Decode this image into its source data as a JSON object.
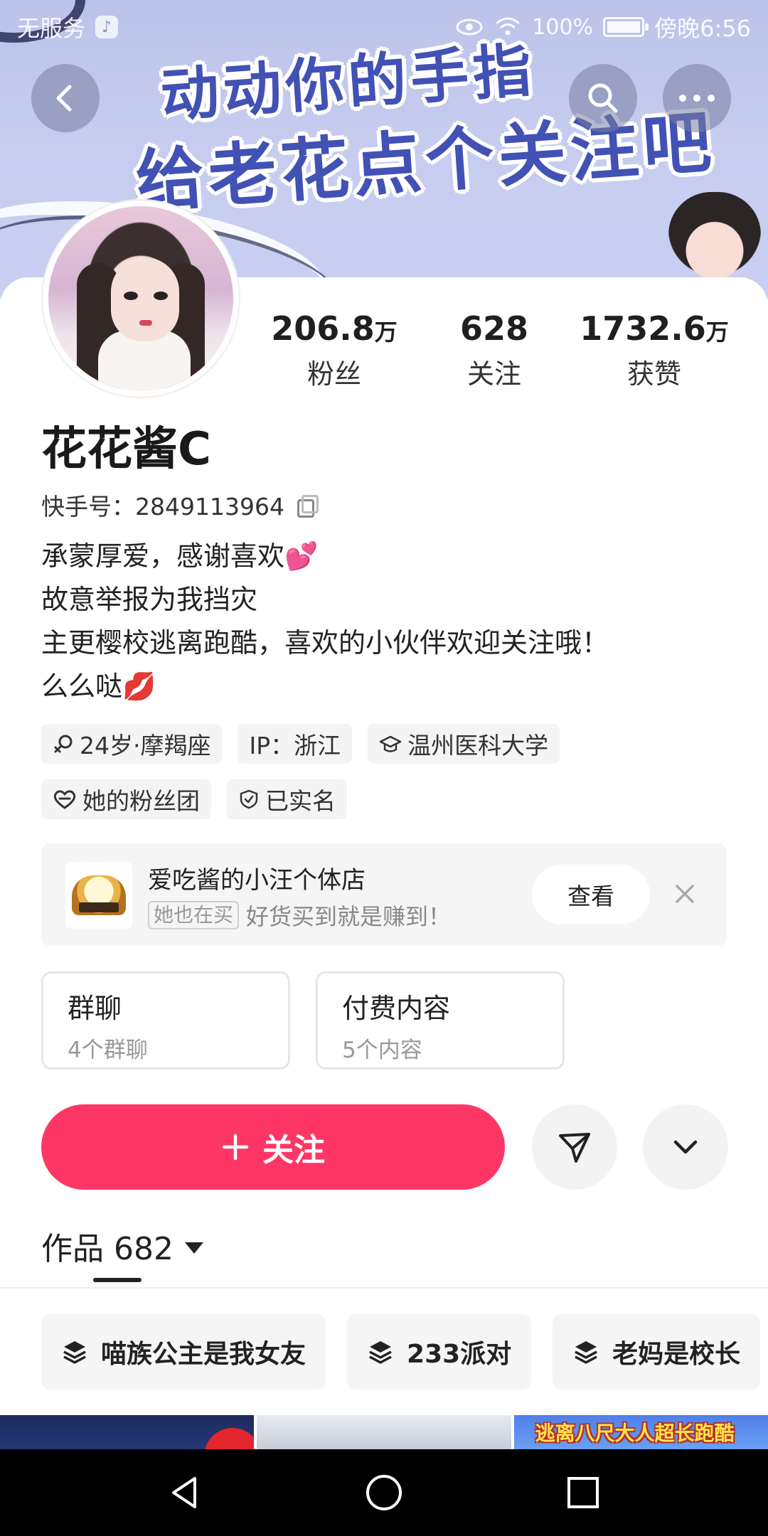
{
  "status_bar": {
    "carrier": "无服务",
    "battery": "100%",
    "time": "傍晚6:56",
    "icons": [
      "music-app-icon",
      "eye-icon",
      "wifi-icon",
      "battery-icon"
    ]
  },
  "banner": {
    "line1": "动动你的手指",
    "line2": "给老花点个关注吧"
  },
  "profile": {
    "stats": [
      {
        "value": "206.8",
        "unit": "万",
        "label": "粉丝"
      },
      {
        "value": "628",
        "unit": "",
        "label": "关注"
      },
      {
        "value": "1732.6",
        "unit": "万",
        "label": "获赞"
      }
    ],
    "name": "花花酱C",
    "kuaishou_id": "快手号：2849113964",
    "bio": [
      {
        "text": "承蒙厚爱，感谢喜欢",
        "emoji": "💕"
      },
      {
        "text": "故意举报为我挡灾",
        "emoji": ""
      },
      {
        "text": "主更樱校逃离跑酷，喜欢的小伙伴欢迎关注哦！",
        "emoji": ""
      },
      {
        "text": "么么哒",
        "emoji": "💋"
      }
    ],
    "tags_row1": [
      {
        "icon": "female-icon",
        "label": "24岁·摩羯座"
      },
      {
        "icon": "",
        "label": "IP：浙江"
      },
      {
        "icon": "graduation-cap-icon",
        "label": "温州医科大学"
      }
    ],
    "tags_row2": [
      {
        "icon": "heart-icon",
        "label": "她的粉丝团"
      },
      {
        "icon": "verified-shield-icon",
        "label": "已实名"
      }
    ]
  },
  "shop": {
    "title": "爱吃酱的小汪个体店",
    "badge": "她也在买",
    "slogan": "好货买到就是赚到！",
    "view_label": "查看"
  },
  "entries": [
    {
      "title": "群聊",
      "sub": "4个群聊"
    },
    {
      "title": "付费内容",
      "sub": "5个内容"
    }
  ],
  "actions": {
    "follow_label": "关注"
  },
  "works": {
    "label": "作品 682"
  },
  "collections": [
    {
      "label": "喵族公主是我女友"
    },
    {
      "label": "233派对"
    },
    {
      "label": "老妈是校长"
    }
  ],
  "thumbnails": {
    "caption3": "逃离八尺大人超长跑酷"
  },
  "colors": {
    "accent": "#fe3666",
    "banner_text": "#4251b4"
  }
}
